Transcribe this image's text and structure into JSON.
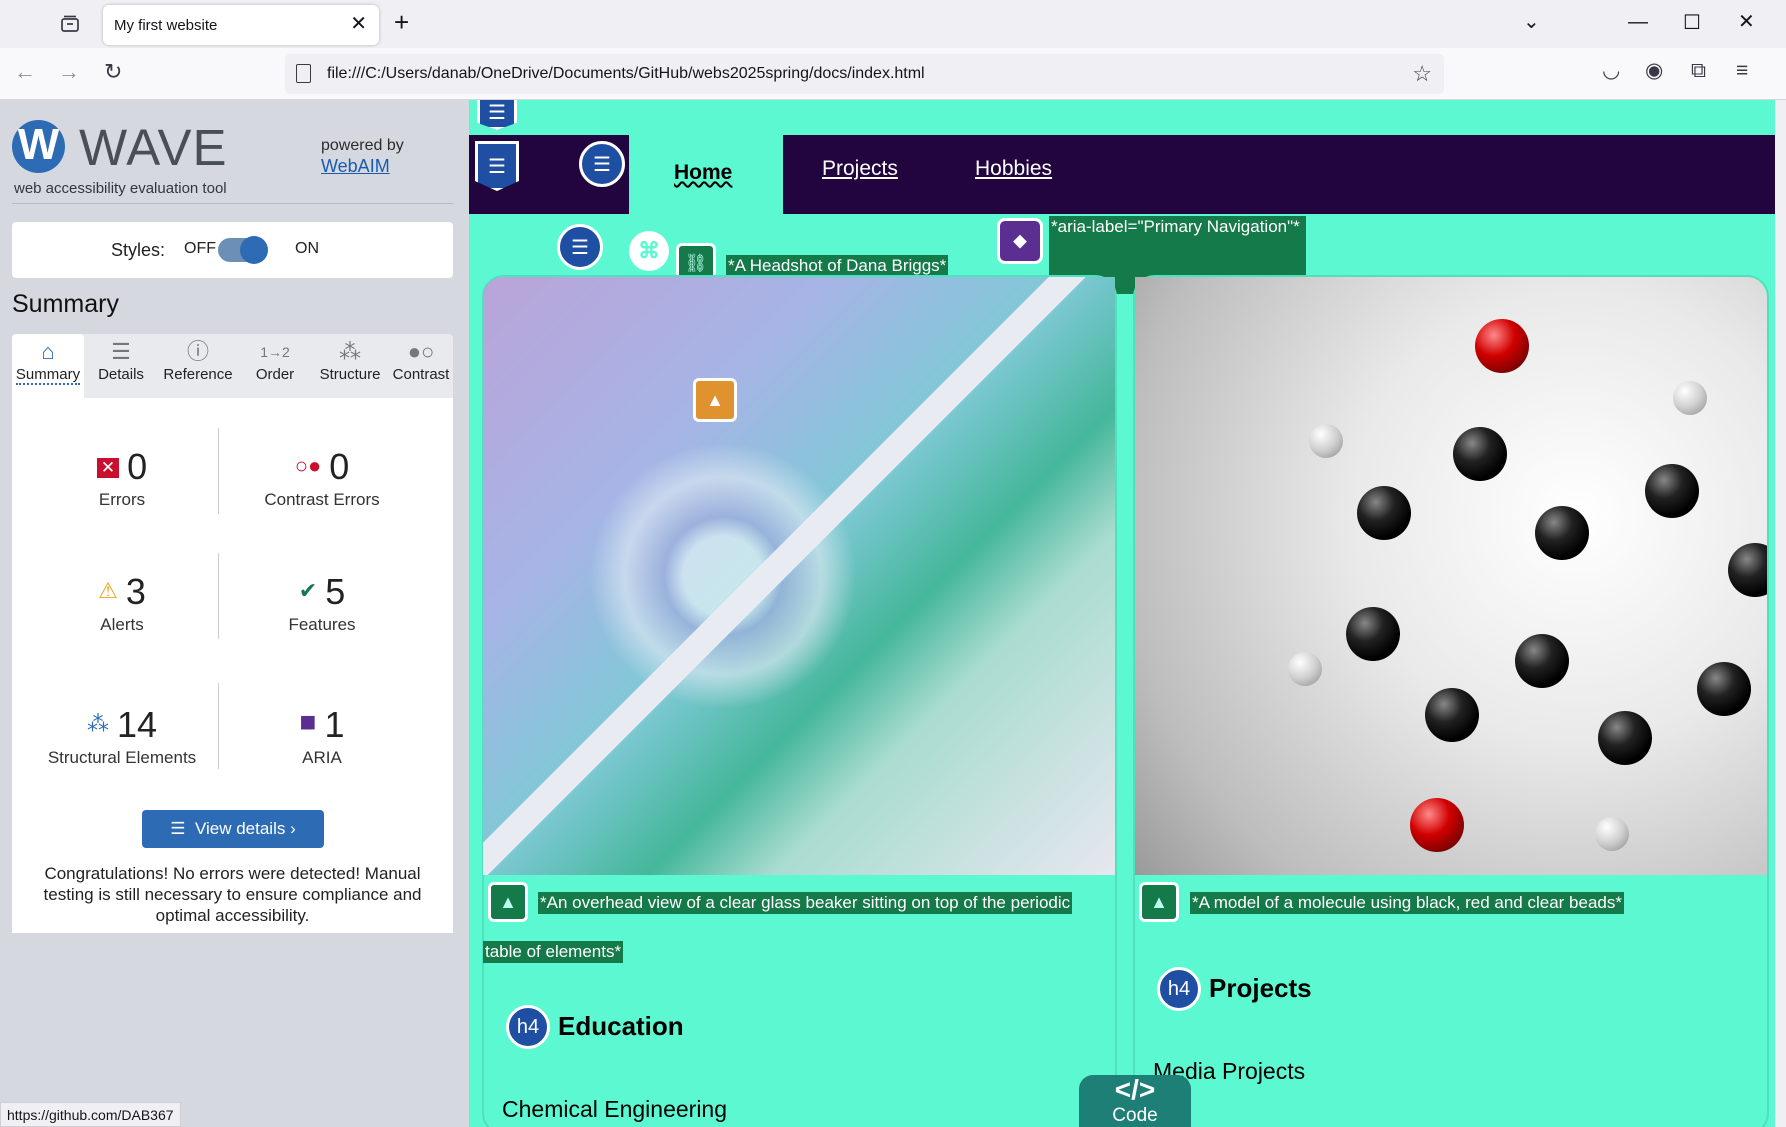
{
  "browser": {
    "tab_title": "My first website",
    "tab_close": "✕",
    "new_tab": "+",
    "url": "file:///C:/Users/danab/OneDrive/Documents/GitHub/webs2025spring/docs/index.html",
    "status_url": "https://github.com/DAB367"
  },
  "wave": {
    "logo_letter": "W",
    "title": "WAVE",
    "subtitle": "web accessibility evaluation tool",
    "powered_by": "powered by",
    "webaim_link": "WebAIM",
    "styles_label": "Styles:",
    "styles_off": "OFF",
    "styles_on": "ON",
    "summary_heading": "Summary",
    "tabs": [
      {
        "label": "Summary",
        "icon": "home-icon"
      },
      {
        "label": "Details",
        "icon": "list-icon"
      },
      {
        "label": "Reference",
        "icon": "info-icon"
      },
      {
        "label": "Order",
        "icon": "order-icon"
      },
      {
        "label": "Structure",
        "icon": "structure-icon"
      },
      {
        "label": "Contrast",
        "icon": "contrast-icon"
      }
    ],
    "stats": {
      "errors": {
        "count": "0",
        "label": "Errors"
      },
      "contrast_errors": {
        "count": "0",
        "label": "Contrast Errors"
      },
      "alerts": {
        "count": "3",
        "label": "Alerts"
      },
      "features": {
        "count": "5",
        "label": "Features"
      },
      "structural": {
        "count": "14",
        "label": "Structural Elements"
      },
      "aria": {
        "count": "1",
        "label": "ARIA"
      }
    },
    "view_details": "View details ›",
    "congrats": "Congratulations! No errors were detected! Manual testing is still necessary to ensure compliance and optimal accessibility."
  },
  "site": {
    "nav": {
      "home": "Home",
      "projects": "Projects",
      "hobbies": "Hobbies"
    },
    "labels": {
      "headshot": "*A Headshot of Dana Briggs*",
      "aria_nav": "*aria-label=\"Primary Navigation\"*",
      "beaker_alt_1": "*An overhead view of a clear glass beaker sitting on top of the periodic",
      "beaker_alt_2": "table of elements*",
      "molecule_alt": "*A model of a molecule using black, red and clear beads*"
    },
    "h4_badge": "h4",
    "education_heading": "Education",
    "education_text": "Chemical Engineering",
    "projects_heading": "Projects",
    "projects_text": "Media Projects",
    "code_tab_symbol": "</>",
    "code_tab_label": "Code"
  },
  "colors": {
    "site_bg": "#5cf8d2",
    "nav_bg": "#22053e",
    "wave_blue": "#2e6bb5",
    "feature_green": "#157a4a"
  }
}
